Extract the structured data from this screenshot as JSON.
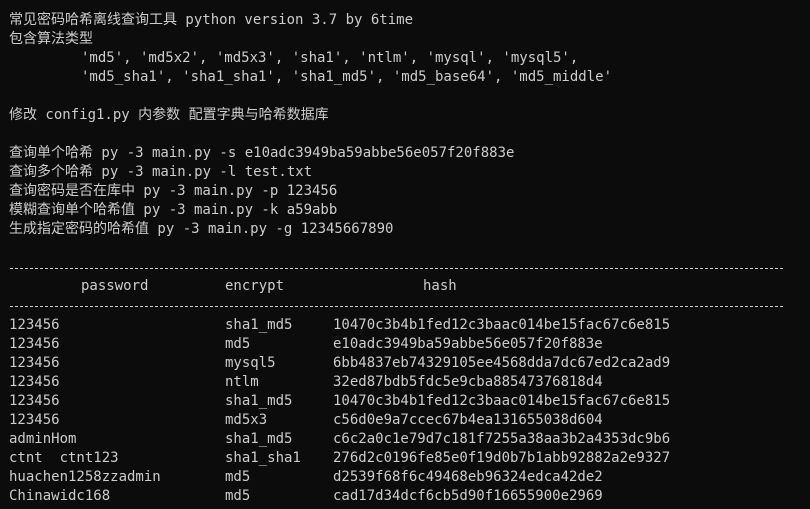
{
  "header": {
    "title": "常见密码哈希离线查询工具 python version 3.7 by 6time",
    "algo_heading": "包含算法类型",
    "algo_list_1": "'md5', 'md5x2', 'md5x3', 'sha1', 'ntlm', 'mysql', 'mysql5',",
    "algo_list_2": "'md5_sha1', 'sha1_sha1', 'sha1_md5', 'md5_base64', 'md5_middle'"
  },
  "config_note": "修改 config1.py 内参数 配置字典与哈希数据库",
  "usage": [
    "查询单个哈希 py -3 main.py -s e10adc3949ba59abbe56e057f20f883e",
    "查询多个哈希 py -3 main.py -l test.txt",
    "查询密码是否在库中 py -3 main.py -p 123456",
    "模糊查询单个哈希值 py -3 main.py -k a59abb",
    "生成指定密码的哈希值 py -3 main.py -g 12345667890"
  ],
  "table": {
    "headers": {
      "password": "password",
      "encrypt": "encrypt",
      "hash": "hash"
    },
    "rows": [
      {
        "password": "123456",
        "encrypt": "sha1_md5",
        "hash": "10470c3b4b1fed12c3baac014be15fac67c6e815"
      },
      {
        "password": "123456",
        "encrypt": "md5",
        "hash": "e10adc3949ba59abbe56e057f20f883e"
      },
      {
        "password": "123456",
        "encrypt": "mysql5",
        "hash": "6bb4837eb74329105ee4568dda7dc67ed2ca2ad9"
      },
      {
        "password": "123456",
        "encrypt": "ntlm",
        "hash": "32ed87bdb5fdc5e9cba88547376818d4"
      },
      {
        "password": "123456",
        "encrypt": "sha1_md5",
        "hash": "10470c3b4b1fed12c3baac014be15fac67c6e815"
      },
      {
        "password": "123456",
        "encrypt": "md5x3",
        "hash": "c56d0e9a7ccec67b4ea131655038d604"
      },
      {
        "password": "adminHom",
        "encrypt": "sha1_md5",
        "hash": "c6c2a0c1e79d7c181f7255a38aa3b2a4353dc9b6"
      },
      {
        "password": "ctnt  ctnt123",
        "encrypt": "sha1_sha1",
        "hash": "276d2c0196fe85e0f19d0b7b1abb92882a2e9327"
      },
      {
        "password": "huachen1258zzadmin",
        "encrypt": "md5",
        "hash": "d2539f68f6c49468eb96324edca42de2"
      },
      {
        "password": "Chinawidc168",
        "encrypt": "md5",
        "hash": "cad17d34dcf6cb5d90f16655900e2969"
      }
    ]
  },
  "colors": {
    "background": "#0c0c0c",
    "foreground": "#cccccc"
  }
}
